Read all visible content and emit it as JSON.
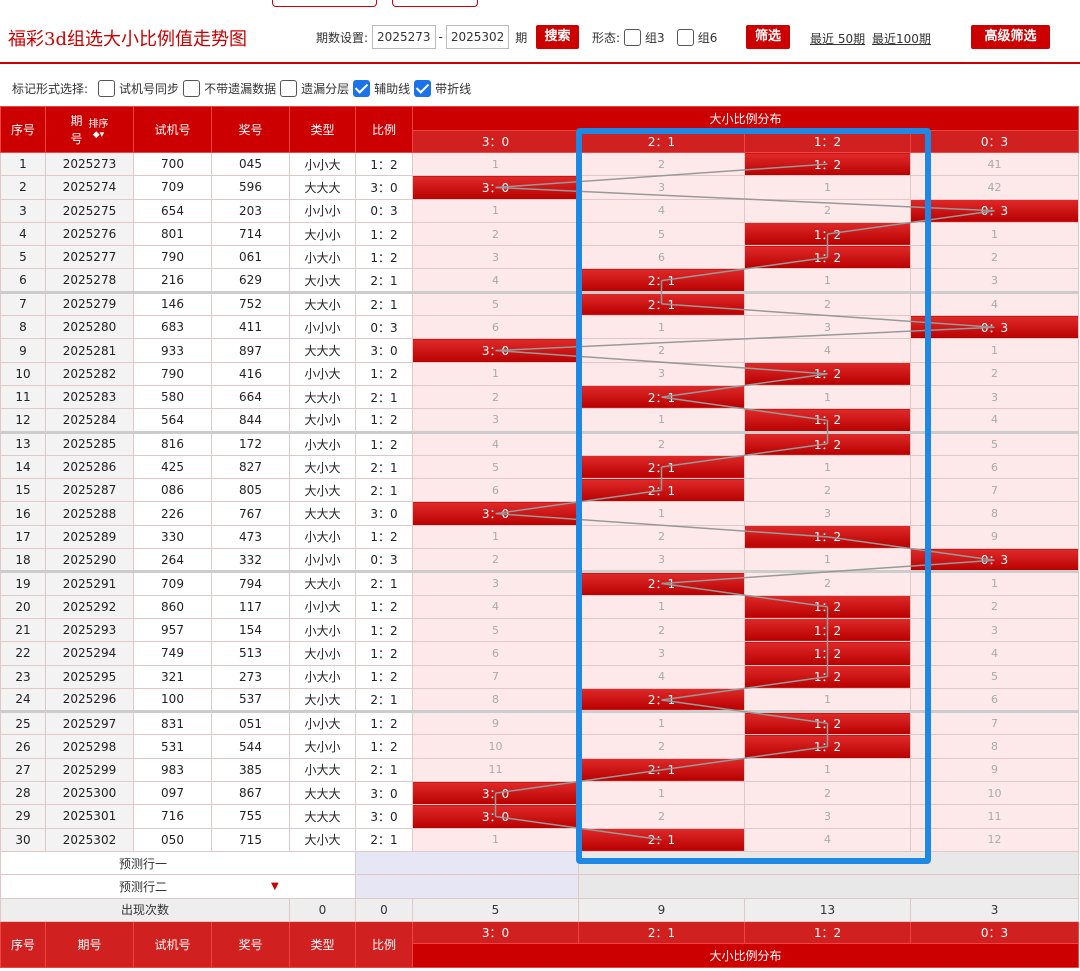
{
  "title": "福彩3d组选大小比例值走势图",
  "controls": {
    "period_label": "期数设置:",
    "start": "2025273",
    "dash": "-",
    "end": "2025302",
    "qi": "期",
    "search_btn": "搜索",
    "form_label": "形态:",
    "group3": "组3",
    "group6": "组6",
    "filter_btn": "筛选",
    "recent50": "最近 50期",
    "recent100": "最近100期",
    "advanced_btn": "高级筛选"
  },
  "options": {
    "label": "标记形式选择:",
    "items": [
      {
        "label": "试机号同步",
        "checked": false
      },
      {
        "label": "不带遗漏数据",
        "checked": false
      },
      {
        "label": "遗漏分层",
        "checked": false
      },
      {
        "label": "辅助线",
        "checked": true
      },
      {
        "label": "带折线",
        "checked": true
      }
    ]
  },
  "headers": {
    "seq": "序号",
    "period_a": "期",
    "period_b": "号",
    "sort": "排序",
    "trial": "试机号",
    "draw": "奖号",
    "type": "类型",
    "ratio": "比例",
    "dist": "大小比例分布",
    "cols": [
      "3：0",
      "2：1",
      "1：2",
      "0：3"
    ]
  },
  "rows": [
    {
      "seq": "1",
      "period": "2025273",
      "trial": "700",
      "draw": "045",
      "type": "小小大",
      "ratio": "1：2",
      "hit": 2,
      "miss": [
        "1",
        "2",
        "",
        "41"
      ]
    },
    {
      "seq": "2",
      "period": "2025274",
      "trial": "709",
      "draw": "596",
      "type": "大大大",
      "ratio": "3：0",
      "hit": 0,
      "miss": [
        "",
        "3",
        "1",
        "42"
      ]
    },
    {
      "seq": "3",
      "period": "2025275",
      "trial": "654",
      "draw": "203",
      "type": "小小小",
      "ratio": "0：3",
      "hit": 3,
      "miss": [
        "1",
        "4",
        "2",
        ""
      ]
    },
    {
      "seq": "4",
      "period": "2025276",
      "trial": "801",
      "draw": "714",
      "type": "大小小",
      "ratio": "1：2",
      "hit": 2,
      "miss": [
        "2",
        "5",
        "",
        "1"
      ]
    },
    {
      "seq": "5",
      "period": "2025277",
      "trial": "790",
      "draw": "061",
      "type": "小大小",
      "ratio": "1：2",
      "hit": 2,
      "miss": [
        "3",
        "6",
        "",
        "2"
      ]
    },
    {
      "seq": "6",
      "period": "2025278",
      "trial": "216",
      "draw": "629",
      "type": "大小大",
      "ratio": "2：1",
      "hit": 1,
      "miss": [
        "4",
        "",
        "1",
        "3"
      ]
    },
    {
      "seq": "7",
      "period": "2025279",
      "trial": "146",
      "draw": "752",
      "type": "大大小",
      "ratio": "2：1",
      "hit": 1,
      "miss": [
        "5",
        "",
        "2",
        "4"
      ]
    },
    {
      "seq": "8",
      "period": "2025280",
      "trial": "683",
      "draw": "411",
      "type": "小小小",
      "ratio": "0：3",
      "hit": 3,
      "miss": [
        "6",
        "1",
        "3",
        ""
      ]
    },
    {
      "seq": "9",
      "period": "2025281",
      "trial": "933",
      "draw": "897",
      "type": "大大大",
      "ratio": "3：0",
      "hit": 0,
      "miss": [
        "",
        "2",
        "4",
        "1"
      ]
    },
    {
      "seq": "10",
      "period": "2025282",
      "trial": "790",
      "draw": "416",
      "type": "小小大",
      "ratio": "1：2",
      "hit": 2,
      "miss": [
        "1",
        "3",
        "",
        "2"
      ]
    },
    {
      "seq": "11",
      "period": "2025283",
      "trial": "580",
      "draw": "664",
      "type": "大大小",
      "ratio": "2：1",
      "hit": 1,
      "miss": [
        "2",
        "",
        "1",
        "3"
      ]
    },
    {
      "seq": "12",
      "period": "2025284",
      "trial": "564",
      "draw": "844",
      "type": "大小小",
      "ratio": "1：2",
      "hit": 2,
      "miss": [
        "3",
        "1",
        "",
        "4"
      ]
    },
    {
      "seq": "13",
      "period": "2025285",
      "trial": "816",
      "draw": "172",
      "type": "小大小",
      "ratio": "1：2",
      "hit": 2,
      "miss": [
        "4",
        "2",
        "",
        "5"
      ]
    },
    {
      "seq": "14",
      "period": "2025286",
      "trial": "425",
      "draw": "827",
      "type": "大小大",
      "ratio": "2：1",
      "hit": 1,
      "miss": [
        "5",
        "",
        "1",
        "6"
      ]
    },
    {
      "seq": "15",
      "period": "2025287",
      "trial": "086",
      "draw": "805",
      "type": "大小大",
      "ratio": "2：1",
      "hit": 1,
      "miss": [
        "6",
        "",
        "2",
        "7"
      ]
    },
    {
      "seq": "16",
      "period": "2025288",
      "trial": "226",
      "draw": "767",
      "type": "大大大",
      "ratio": "3：0",
      "hit": 0,
      "miss": [
        "",
        "1",
        "3",
        "8"
      ]
    },
    {
      "seq": "17",
      "period": "2025289",
      "trial": "330",
      "draw": "473",
      "type": "小大小",
      "ratio": "1：2",
      "hit": 2,
      "miss": [
        "1",
        "2",
        "",
        "9"
      ]
    },
    {
      "seq": "18",
      "period": "2025290",
      "trial": "264",
      "draw": "332",
      "type": "小小小",
      "ratio": "0：3",
      "hit": 3,
      "miss": [
        "2",
        "3",
        "1",
        ""
      ]
    },
    {
      "seq": "19",
      "period": "2025291",
      "trial": "709",
      "draw": "794",
      "type": "大大小",
      "ratio": "2：1",
      "hit": 1,
      "miss": [
        "3",
        "",
        "2",
        "1"
      ]
    },
    {
      "seq": "20",
      "period": "2025292",
      "trial": "860",
      "draw": "117",
      "type": "小小大",
      "ratio": "1：2",
      "hit": 2,
      "miss": [
        "4",
        "1",
        "",
        "2"
      ]
    },
    {
      "seq": "21",
      "period": "2025293",
      "trial": "957",
      "draw": "154",
      "type": "小大小",
      "ratio": "1：2",
      "hit": 2,
      "miss": [
        "5",
        "2",
        "",
        "3"
      ]
    },
    {
      "seq": "22",
      "period": "2025294",
      "trial": "749",
      "draw": "513",
      "type": "大小小",
      "ratio": "1：2",
      "hit": 2,
      "miss": [
        "6",
        "3",
        "",
        "4"
      ]
    },
    {
      "seq": "23",
      "period": "2025295",
      "trial": "321",
      "draw": "273",
      "type": "小大小",
      "ratio": "1：2",
      "hit": 2,
      "miss": [
        "7",
        "4",
        "",
        "5"
      ]
    },
    {
      "seq": "24",
      "period": "2025296",
      "trial": "100",
      "draw": "537",
      "type": "大小大",
      "ratio": "2：1",
      "hit": 1,
      "miss": [
        "8",
        "",
        "1",
        "6"
      ]
    },
    {
      "seq": "25",
      "period": "2025297",
      "trial": "831",
      "draw": "051",
      "type": "小小大",
      "ratio": "1：2",
      "hit": 2,
      "miss": [
        "9",
        "1",
        "",
        "7"
      ]
    },
    {
      "seq": "26",
      "period": "2025298",
      "trial": "531",
      "draw": "544",
      "type": "大小小",
      "ratio": "1：2",
      "hit": 2,
      "miss": [
        "10",
        "2",
        "",
        "8"
      ]
    },
    {
      "seq": "27",
      "period": "2025299",
      "trial": "983",
      "draw": "385",
      "type": "小大大",
      "ratio": "2：1",
      "hit": 1,
      "miss": [
        "11",
        "",
        "1",
        "9"
      ]
    },
    {
      "seq": "28",
      "period": "2025300",
      "trial": "097",
      "draw": "867",
      "type": "大大大",
      "ratio": "3：0",
      "hit": 0,
      "miss": [
        "",
        "1",
        "2",
        "10"
      ]
    },
    {
      "seq": "29",
      "period": "2025301",
      "trial": "716",
      "draw": "755",
      "type": "大大大",
      "ratio": "3：0",
      "hit": 0,
      "miss": [
        "",
        "2",
        "3",
        "11"
      ]
    },
    {
      "seq": "30",
      "period": "2025302",
      "trial": "050",
      "draw": "715",
      "type": "大小大",
      "ratio": "2：1",
      "hit": 1,
      "miss": [
        "1",
        "",
        "4",
        "12"
      ]
    }
  ],
  "predict": [
    "预测行一",
    "预测行二"
  ],
  "footer": {
    "label": "出现次数",
    "type_count": "0",
    "ratio_count": "0",
    "counts": [
      "5",
      "9",
      "13",
      "3"
    ]
  },
  "colors": {
    "accent": "#cc0000",
    "highlight": "#1e88e5",
    "miss_bg": "#fde9e9"
  }
}
